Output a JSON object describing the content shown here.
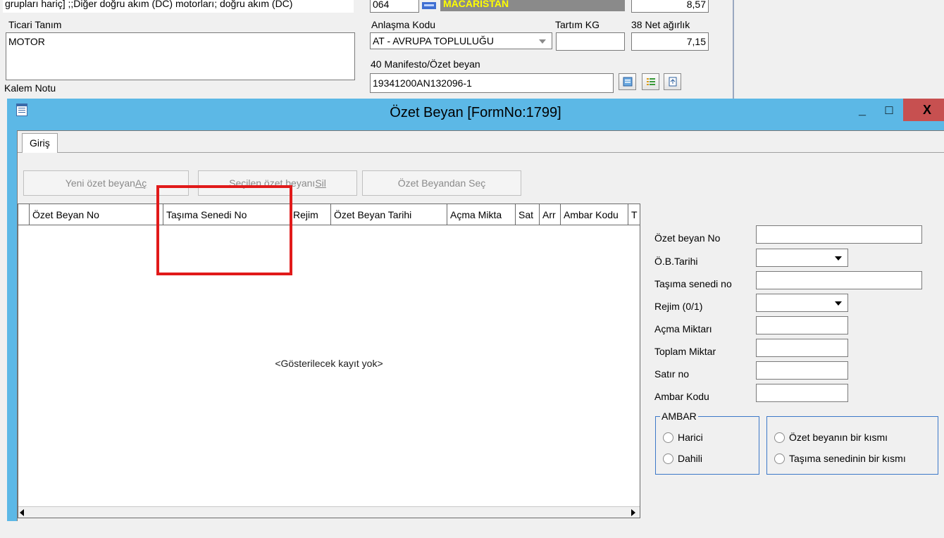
{
  "background_form": {
    "description_text": "grupları hariç] ;;Diğer doğru akım (DC) motorları; doğru akım (DC)",
    "ticari_tanim_label": "Ticari Tanım",
    "ticari_tanim_value": "MOTOR",
    "kalem_notu_label": "Kalem Notu",
    "country_code": "064",
    "country_name": "MACARISTAN",
    "top_right_value": "8,57",
    "anlasma_kodu_label": "Anlaşma Kodu",
    "anlasma_kodu_value": "AT   - AVRUPA TOPLULUĞU",
    "tartim_kg_label": "Tartım KG",
    "net_agirlik_label": "38 Net ağırlık",
    "net_agirlik_value": "7,15",
    "manifesto_label": "40 Manifesto/Özet beyan",
    "manifesto_value": "19341200AN132096-1"
  },
  "window": {
    "title": "Özet Beyan [FormNo:1799]",
    "minimize_glyph": "_",
    "maximize_glyph": "□",
    "close_glyph": "X"
  },
  "tabs": [
    {
      "label": "Giriş"
    }
  ],
  "buttons": {
    "new_prefix": "Yeni özet beyan ",
    "new_hotkey": "Aç",
    "delete_prefix": "Seçilen özet beyanı ",
    "delete_hotkey": "Sil",
    "select": "Özet Beyandan Seç"
  },
  "grid": {
    "columns": [
      "Özet Beyan No",
      "Taşıma Senedi No",
      "Rejim",
      "Özet Beyan Tarihi",
      "Açma Mikta",
      "Sat",
      "Arr",
      "Ambar Kodu",
      "T"
    ],
    "empty_text": "<Gösterilecek kayıt yok>"
  },
  "form": {
    "ozet_beyan_no_label": "Özet beyan No",
    "ob_tarihi_label": "Ö.B.Tarihi",
    "tasima_senedi_no_label": "Taşıma senedi no",
    "rejim_label": "Rejim  (0/1)",
    "acma_miktari_label": "Açma Miktarı",
    "toplam_miktar_label": "Toplam Miktar",
    "satir_no_label": "Satır no",
    "ambar_kodu_label": "Ambar Kodu"
  },
  "ambar_group": {
    "legend": "AMBAR",
    "options": [
      "Harici",
      "Dahili"
    ]
  },
  "kisim_group": {
    "options": [
      "Özet beyanın bir kısmı",
      "Taşıma senedinin bir kısmı"
    ]
  },
  "colors": {
    "window_chrome": "#5cb8e6",
    "close_button": "#c75050",
    "country_highlight": "#ffff00",
    "annotation_box": "#e11a1a"
  }
}
